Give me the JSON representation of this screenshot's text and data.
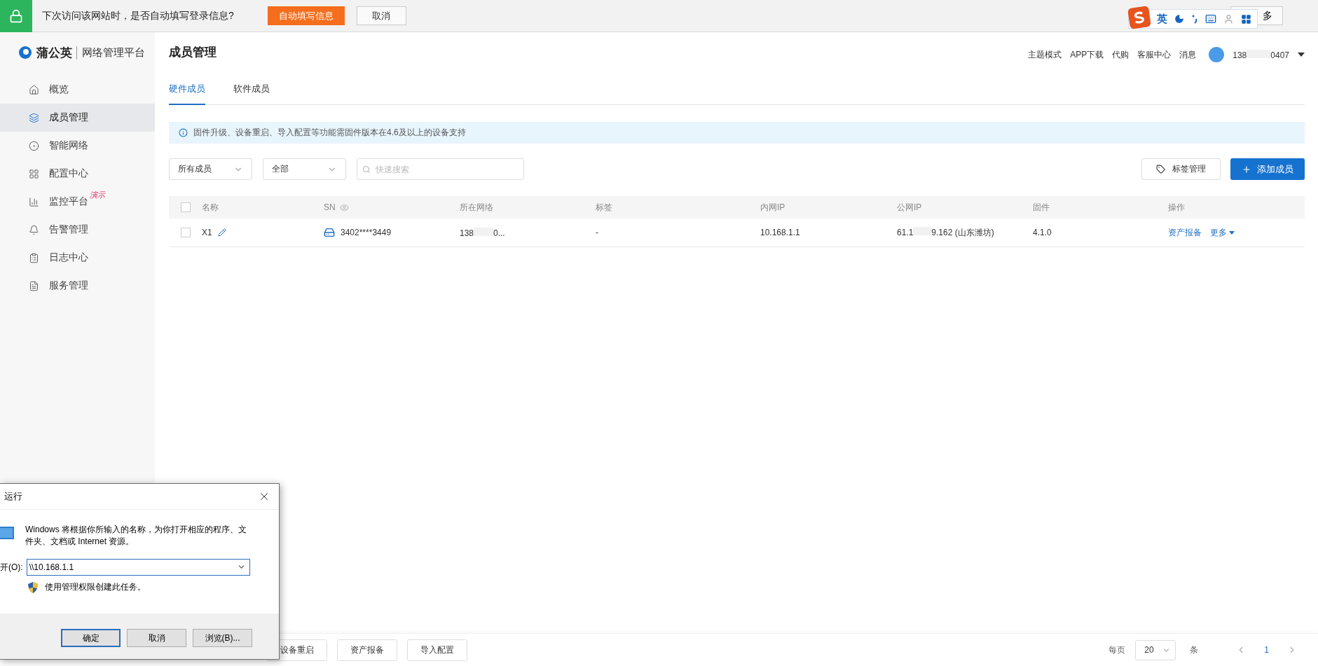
{
  "autofill_bar": {
    "message": "下次访问该网站时，是否自动填写登录信息?",
    "fill_button": "自动填写信息",
    "cancel_button": "取消",
    "more_button": "多"
  },
  "ime_toolbar": {
    "mode": "英"
  },
  "sidebar": {
    "logo_name": "蒲公英",
    "logo_subtitle": "网络管理平台",
    "items": [
      {
        "label": "概览",
        "selected": false
      },
      {
        "label": "成员管理",
        "selected": true
      },
      {
        "label": "智能网络",
        "selected": false
      },
      {
        "label": "配置中心",
        "selected": false
      },
      {
        "label": "监控平台",
        "selected": false,
        "badge": "演示"
      },
      {
        "label": "告警管理",
        "selected": false
      },
      {
        "label": "日志中心",
        "selected": false
      },
      {
        "label": "服务管理",
        "selected": false
      }
    ]
  },
  "header": {
    "title": "成员管理",
    "links": [
      "主题模式",
      "APP下载",
      "代购",
      "客服中心",
      "消息"
    ],
    "user": {
      "name_start": "138",
      "name_end": "0407"
    }
  },
  "tabs": [
    {
      "label": "硬件成员",
      "selected": true
    },
    {
      "label": "软件成员",
      "selected": false
    }
  ],
  "notice": "固件升级、设备重启、导入配置等功能需固件版本在4.6及以上的设备支持",
  "filters": {
    "member_select": "所有成员",
    "status_select": "全部",
    "search": {
      "placeholder": "快速搜索"
    }
  },
  "actions": {
    "tag_button": "标签管理",
    "add_button": "添加成员"
  },
  "table": {
    "header_checked": false,
    "columns": [
      "名称",
      "SN",
      "所在网络",
      "标签",
      "内网IP",
      "公网IP",
      "固件",
      "操作"
    ],
    "rows": [
      {
        "checked": false,
        "name": "X1",
        "sn": "3402****3449",
        "network_start": "138",
        "network_end": "0...",
        "tag": "-",
        "lan_ip": "10.168.1.1",
        "wan_ip_start": "61.1",
        "wan_ip_end": "9.162 (山东潍坊)",
        "firmware": "4.1.0",
        "actions": [
          "资产报备",
          "更多"
        ]
      }
    ]
  },
  "bottom_bar": {
    "buttons": [
      "设备重启",
      "资产报备",
      "导入配置"
    ],
    "page_size_label": "每页",
    "page_size": "20",
    "unit": "条",
    "pages": [
      {
        "label": "1",
        "selected": true
      }
    ]
  },
  "run_dialog": {
    "title": "运行",
    "message": "Windows 将根据你所输入的名称，为你打开相应的程序、文件夹、文档或 Internet 资源。",
    "open_label": "开(O):",
    "value": "\\\\10.168.1.1",
    "admin_note": "使用管理权限创建此任务。",
    "buttons": [
      {
        "label": "确定",
        "selected": true
      },
      {
        "label": "取消",
        "selected": false
      },
      {
        "label": "浏览(B)...",
        "selected": false
      }
    ]
  }
}
